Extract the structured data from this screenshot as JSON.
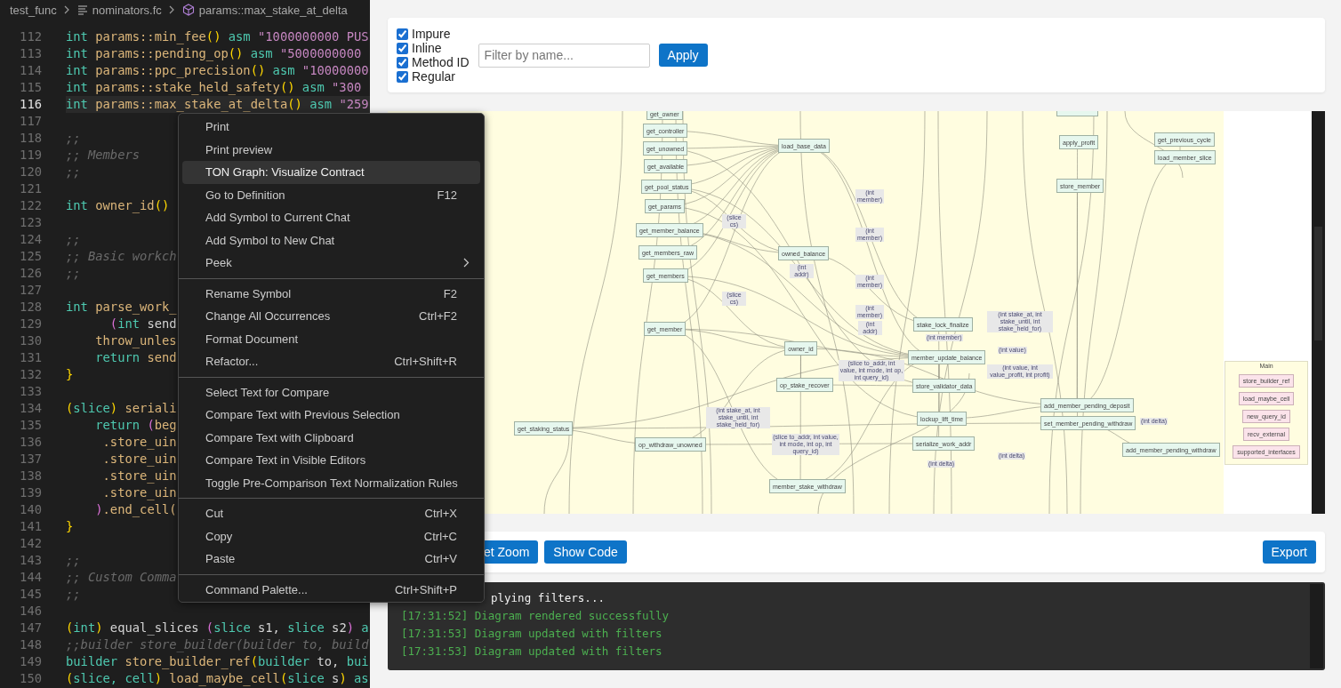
{
  "breadcrumb": [
    {
      "text": "test_func",
      "kind": "folder"
    },
    {
      "text": "nominators.fc",
      "kind": "file"
    },
    {
      "text": "params::max_stake_at_delta",
      "kind": "symbol"
    }
  ],
  "editor": {
    "lines": [
      {
        "number": "112",
        "current": false,
        "tokens": [
          {
            "t": "int",
            "kind": "type"
          },
          {
            "t": " params::min_fee",
            "kind": "fn"
          },
          {
            "t": "()",
            "kind": "paren"
          },
          {
            "t": " asm ",
            "kind": "type"
          },
          {
            "t": "\"1000000000 PUS",
            "kind": "str"
          }
        ]
      },
      {
        "number": "113",
        "current": false,
        "tokens": [
          {
            "t": "int",
            "kind": "type"
          },
          {
            "t": " params::pending_op",
            "kind": "fn"
          },
          {
            "t": "()",
            "kind": "paren"
          },
          {
            "t": " asm ",
            "kind": "type"
          },
          {
            "t": "\"5000000000",
            "kind": "str"
          }
        ]
      },
      {
        "number": "114",
        "current": false,
        "tokens": [
          {
            "t": "int",
            "kind": "type"
          },
          {
            "t": " params::ppc_precision",
            "kind": "fn"
          },
          {
            "t": "()",
            "kind": "paren"
          },
          {
            "t": " asm ",
            "kind": "type"
          },
          {
            "t": "\"10000000",
            "kind": "str"
          }
        ]
      },
      {
        "number": "115",
        "current": false,
        "tokens": [
          {
            "t": "int",
            "kind": "type"
          },
          {
            "t": " params::stake_held_safety",
            "kind": "fn"
          },
          {
            "t": "()",
            "kind": "paren"
          },
          {
            "t": " asm ",
            "kind": "type"
          },
          {
            "t": "\"300",
            "kind": "str"
          }
        ]
      },
      {
        "number": "116",
        "current": true,
        "tokens": [
          {
            "t": "int",
            "kind": "type"
          },
          {
            "t": " params::max_stake_at_delta",
            "kind": "fn"
          },
          {
            "t": "()",
            "kind": "paren"
          },
          {
            "t": " asm ",
            "kind": "type"
          },
          {
            "t": "\"259",
            "kind": "str"
          }
        ]
      },
      {
        "number": "117",
        "current": false
      },
      {
        "number": "118",
        "current": false,
        "tokens": [
          {
            "t": ";;",
            "kind": "com"
          }
        ]
      },
      {
        "number": "119",
        "current": false,
        "tokens": [
          {
            "t": ";; Members",
            "kind": "com"
          }
        ]
      },
      {
        "number": "120",
        "current": false,
        "tokens": [
          {
            "t": ";;",
            "kind": "com"
          }
        ]
      },
      {
        "number": "121",
        "current": false
      },
      {
        "number": "122",
        "current": false,
        "tokens": [
          {
            "t": "int",
            "kind": "type"
          },
          {
            "t": " owner_id",
            "kind": "fn"
          },
          {
            "t": "()",
            "kind": "paren"
          }
        ]
      },
      {
        "number": "123",
        "current": false
      },
      {
        "number": "124",
        "current": false,
        "tokens": [
          {
            "t": ";;",
            "kind": "com"
          }
        ]
      },
      {
        "number": "125",
        "current": false,
        "tokens": [
          {
            "t": ";; Basic workch",
            "kind": "com"
          }
        ]
      },
      {
        "number": "126",
        "current": false,
        "tokens": [
          {
            "t": ";;",
            "kind": "com"
          }
        ]
      },
      {
        "number": "127",
        "current": false
      },
      {
        "number": "128",
        "current": false,
        "tokens": [
          {
            "t": "int",
            "kind": "type"
          },
          {
            "t": " parse_work_",
            "kind": "fn"
          }
        ]
      },
      {
        "number": "129",
        "current": false,
        "tokens": [
          {
            "t": "      (",
            "kind": "paren2"
          },
          {
            "t": "int",
            "kind": "type"
          },
          {
            "t": " send",
            "kind": "plain"
          }
        ]
      },
      {
        "number": "130",
        "current": false,
        "tokens": [
          {
            "t": "    throw_unles",
            "kind": "fn"
          }
        ]
      },
      {
        "number": "131",
        "current": false,
        "tokens": [
          {
            "t": "    return",
            "kind": "type"
          },
          {
            "t": " send",
            "kind": "fn"
          }
        ]
      },
      {
        "number": "132",
        "current": false,
        "tokens": [
          {
            "t": "}",
            "kind": "paren"
          }
        ]
      },
      {
        "number": "133",
        "current": false
      },
      {
        "number": "134",
        "current": false,
        "tokens": [
          {
            "t": "(",
            "kind": "paren"
          },
          {
            "t": "slice",
            "kind": "type"
          },
          {
            "t": ")",
            "kind": "paren"
          },
          {
            "t": " seriali",
            "kind": "fn"
          }
        ]
      },
      {
        "number": "135",
        "current": false,
        "tokens": [
          {
            "t": "    return",
            "kind": "type"
          },
          {
            "t": " (",
            "kind": "paren2"
          },
          {
            "t": "beg",
            "kind": "fn"
          }
        ]
      },
      {
        "number": "136",
        "current": false,
        "tokens": [
          {
            "t": "     .store_uin",
            "kind": "fn"
          }
        ]
      },
      {
        "number": "137",
        "current": false,
        "tokens": [
          {
            "t": "     .store_uin",
            "kind": "fn"
          }
        ]
      },
      {
        "number": "138",
        "current": false,
        "tokens": [
          {
            "t": "     .store_uin",
            "kind": "fn"
          }
        ]
      },
      {
        "number": "139",
        "current": false,
        "tokens": [
          {
            "t": "     .store_uin",
            "kind": "fn"
          }
        ]
      },
      {
        "number": "140",
        "current": false,
        "tokens": [
          {
            "t": "    )",
            "kind": "paren2"
          },
          {
            "t": ".end_cell(",
            "kind": "fn"
          }
        ]
      },
      {
        "number": "141",
        "current": false,
        "tokens": [
          {
            "t": "}",
            "kind": "paren"
          }
        ]
      },
      {
        "number": "142",
        "current": false
      },
      {
        "number": "143",
        "current": false,
        "tokens": [
          {
            "t": ";;",
            "kind": "com"
          }
        ]
      },
      {
        "number": "144",
        "current": false,
        "tokens": [
          {
            "t": ";; Custom Comma",
            "kind": "com"
          }
        ]
      },
      {
        "number": "145",
        "current": false,
        "tokens": [
          {
            "t": ";;",
            "kind": "com"
          }
        ]
      },
      {
        "number": "146",
        "current": false
      },
      {
        "number": "147",
        "current": false,
        "tokens": [
          {
            "t": "(",
            "kind": "paren"
          },
          {
            "t": "int",
            "kind": "type"
          },
          {
            "t": ")",
            "kind": "paren"
          },
          {
            "t": " equal_slices ",
            "kind": "plain"
          },
          {
            "t": "(",
            "kind": "paren2"
          },
          {
            "t": "slice",
            "kind": "type"
          },
          {
            "t": " s1, ",
            "kind": "plain"
          },
          {
            "t": "slice",
            "kind": "type"
          },
          {
            "t": " s2",
            "kind": "plain"
          },
          {
            "t": ")",
            "kind": "paren2"
          },
          {
            "t": " a",
            "kind": "type"
          }
        ]
      },
      {
        "number": "148",
        "current": false,
        "tokens": [
          {
            "t": ";;builder store_builder(builder to, build",
            "kind": "com"
          }
        ]
      },
      {
        "number": "149",
        "current": false,
        "tokens": [
          {
            "t": "builder",
            "kind": "type"
          },
          {
            "t": " store_builder_ref",
            "kind": "fn"
          },
          {
            "t": "(",
            "kind": "paren"
          },
          {
            "t": "builder",
            "kind": "type"
          },
          {
            "t": " to, ",
            "kind": "plain"
          },
          {
            "t": "bui",
            "kind": "type"
          }
        ]
      },
      {
        "number": "150",
        "current": false,
        "tokens": [
          {
            "t": "(",
            "kind": "paren"
          },
          {
            "t": "slice, cell",
            "kind": "type"
          },
          {
            "t": ")",
            "kind": "paren"
          },
          {
            "t": " load_maybe_cell",
            "kind": "fn"
          },
          {
            "t": "(",
            "kind": "paren"
          },
          {
            "t": "slice",
            "kind": "type"
          },
          {
            "t": " s",
            "kind": "plain"
          },
          {
            "t": ")",
            "kind": "paren"
          },
          {
            "t": " as",
            "kind": "type"
          }
        ]
      }
    ]
  },
  "context_menu": {
    "groups": [
      {
        "items": [
          {
            "label": "Print",
            "selected": false,
            "submenu": false
          },
          {
            "label": "Print preview",
            "selected": false,
            "submenu": false
          },
          {
            "label": "TON Graph: Visualize Contract",
            "selected": true,
            "submenu": false
          },
          {
            "label": "Go to Definition",
            "shortcut": "F12",
            "selected": false,
            "submenu": false
          },
          {
            "label": "Add Symbol to Current Chat",
            "selected": false,
            "submenu": false
          },
          {
            "label": "Add Symbol to New Chat",
            "selected": false,
            "submenu": false
          },
          {
            "label": "Peek",
            "selected": false,
            "submenu": true
          }
        ]
      },
      {
        "items": [
          {
            "label": "Rename Symbol",
            "shortcut": "F2",
            "selected": false,
            "submenu": false
          },
          {
            "label": "Change All Occurrences",
            "shortcut": "Ctrl+F2",
            "selected": false,
            "submenu": false
          },
          {
            "label": "Format Document",
            "selected": false,
            "submenu": false
          },
          {
            "label": "Refactor...",
            "shortcut": "Ctrl+Shift+R",
            "selected": false,
            "submenu": false
          }
        ]
      },
      {
        "items": [
          {
            "label": "Select Text for Compare",
            "selected": false,
            "submenu": false
          },
          {
            "label": "Compare Text with Previous Selection",
            "selected": false,
            "submenu": false
          },
          {
            "label": "Compare Text with Clipboard",
            "selected": false,
            "submenu": false
          },
          {
            "label": "Compare Text in Visible Editors",
            "selected": false,
            "submenu": false
          },
          {
            "label": "Toggle Pre-Comparison Text Normalization Rules",
            "selected": false,
            "submenu": false
          }
        ]
      },
      {
        "items": [
          {
            "label": "Cut",
            "shortcut": "Ctrl+X",
            "selected": false,
            "submenu": false
          },
          {
            "label": "Copy",
            "shortcut": "Ctrl+C",
            "selected": false,
            "submenu": false
          },
          {
            "label": "Paste",
            "shortcut": "Ctrl+V",
            "selected": false,
            "submenu": false
          }
        ]
      },
      {
        "items": [
          {
            "label": "Command Palette...",
            "shortcut": "Ctrl+Shift+P",
            "selected": false,
            "submenu": false
          }
        ]
      }
    ]
  },
  "filters": {
    "options": [
      {
        "label": "Impure",
        "checked": true
      },
      {
        "label": "Inline",
        "checked": true
      },
      {
        "label": "Method ID",
        "checked": true
      },
      {
        "label": "Regular",
        "checked": true
      }
    ],
    "search": {
      "placeholder": "Filter by name..."
    },
    "apply_button": "Apply"
  },
  "graph": {
    "nodes": [
      {
        "label": "get_owner"
      },
      {
        "label": "get_controller"
      },
      {
        "label": "get_unowned"
      },
      {
        "label": "get_available"
      },
      {
        "label": "get_pool_status"
      },
      {
        "label": "get_params"
      },
      {
        "label": "get_member_balance"
      },
      {
        "label": "get_members_raw"
      },
      {
        "label": "get_members"
      },
      {
        "label": "get_member"
      },
      {
        "label": "get_staking_status"
      },
      {
        "label": "op_withdraw_unowned"
      },
      {
        "label": "load_base_data"
      },
      {
        "label": "owned_balance"
      },
      {
        "label": "owner_id"
      },
      {
        "label": "op_stake_recover"
      },
      {
        "label": "member_stake_withdraw"
      },
      {
        "label": "apply_profit"
      },
      {
        "label": "get_previous_cycle"
      },
      {
        "label": "load_member_slice"
      },
      {
        "label": "store_member"
      },
      {
        "label": "stake_lock_finalize"
      },
      {
        "label": "member_update_balance"
      },
      {
        "label": "store_validator_data"
      },
      {
        "label": "lockup_lift_time"
      },
      {
        "label": "serialize_work_addr"
      },
      {
        "label": "add_member_pending_deposit"
      },
      {
        "label": "set_member_pending_withdraw"
      },
      {
        "label": "add_member_pending_withdraw"
      }
    ],
    "edge_labels": [
      "(int member)",
      "(slice cs)",
      "(int member)",
      "(int addr)",
      "(int member)",
      "(slice cs)",
      "(int member)",
      "(int addr)",
      "(slice to_addr, int value, int mode, int op, int query_id)",
      "(int stake_at, int stake_until, int stake_held_for)",
      "(slice to_addr, int value, int mode, int op, int query_id)",
      "(int stake_at, int stake_until, int stake_held_for)",
      "(int member)",
      "(int value)",
      "(int value, int value_profit, int profit)",
      "(int delta)",
      "(int delta)",
      "(int delta)"
    ],
    "cluster": {
      "title": "Main",
      "nodes": [
        "store_builder_ref",
        "load_maybe_cell",
        "new_query_id",
        "recv_external",
        "supported_interfaces"
      ]
    }
  },
  "toolbar": {
    "left_buttons": [
      "et Zoom",
      "Show Code"
    ],
    "right_buttons": [
      "Export"
    ]
  },
  "log": {
    "lines": [
      {
        "text": "plying filters...",
        "kind": "info"
      },
      {
        "text": "[17:31:52] Diagram rendered successfully",
        "kind": "success"
      },
      {
        "text": "[17:31:53] Diagram updated with filters",
        "kind": "success"
      },
      {
        "text": "[17:31:53] Diagram updated with filters",
        "kind": "success"
      }
    ]
  }
}
